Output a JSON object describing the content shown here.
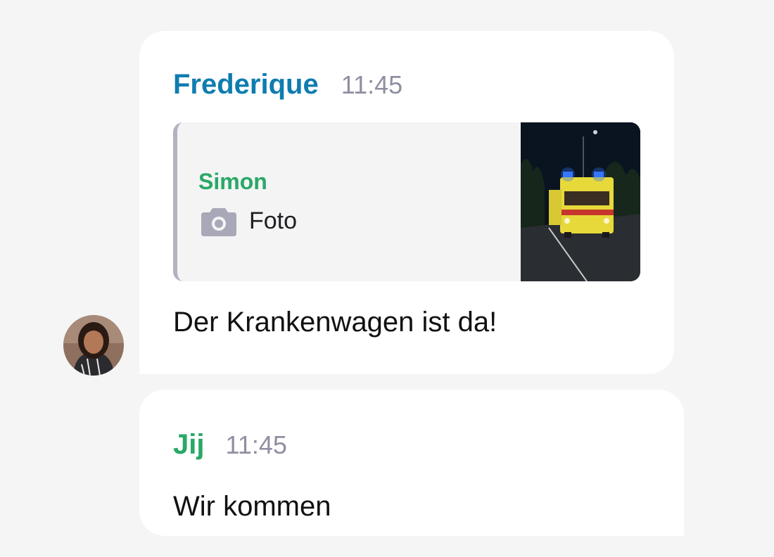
{
  "messages": [
    {
      "sender": "Frederique",
      "time": "11:45",
      "reply": {
        "sender": "Simon",
        "type_icon": "camera-icon",
        "type_label": "Foto",
        "thumbnail": "ambulance-photo-thumbnail"
      },
      "text": "Der Krankenwagen ist da!",
      "avatar": "frederique-avatar"
    },
    {
      "sender": "Jij",
      "time": "11:45",
      "text": "Wir kommen"
    }
  ],
  "colors": {
    "sender_blue": "#0f7cb0",
    "sender_green": "#2aa866",
    "time_gray": "#8e8fa0",
    "quote_bar": "#b2b2c0",
    "background": "#f5f5f6"
  }
}
